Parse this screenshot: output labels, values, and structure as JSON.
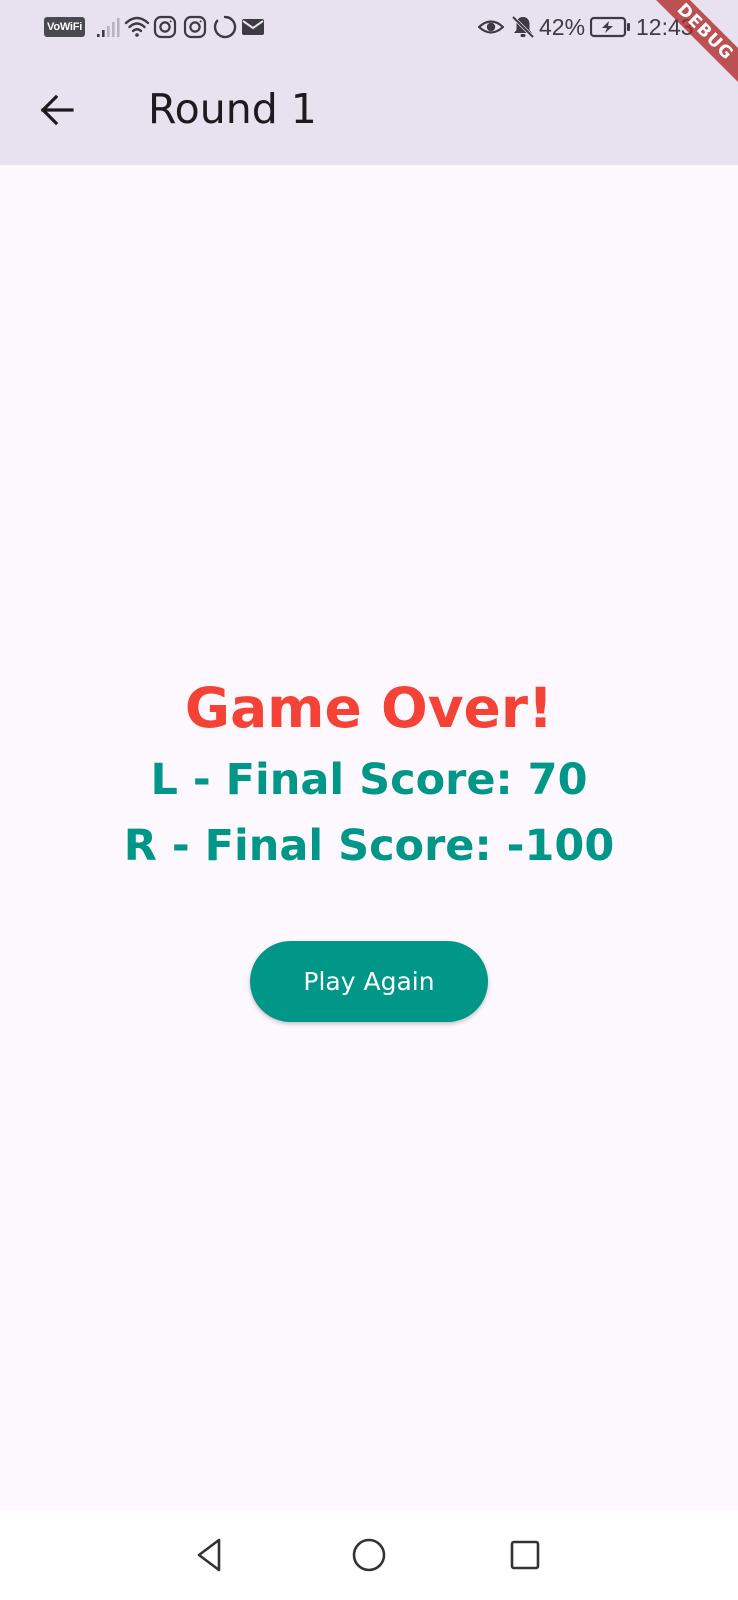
{
  "status_bar": {
    "vowifi_label": "VoWiFi",
    "battery_percent": "42%",
    "time": "12:43",
    "icons": [
      "vowifi-icon",
      "signal-icon",
      "wifi-icon",
      "instagram-icon",
      "instagram-icon",
      "sync-icon",
      "mail-icon",
      "eye-icon",
      "bell-muted-icon",
      "battery-charging-icon"
    ]
  },
  "app_bar": {
    "back_icon": "arrow-back-icon",
    "title": "Round 1"
  },
  "debug_banner": {
    "label": "DEBUG",
    "color": "#B02828"
  },
  "result": {
    "heading": "Game Over!",
    "left_score": "L - Final Score: 70",
    "right_score": "R - Final Score: -100",
    "play_again_label": "Play Again"
  },
  "colors": {
    "heading": "#F44336",
    "score": "#009688",
    "button": "#009688",
    "app_bar": "#E8E1F0",
    "background": "#FDF7FE"
  },
  "nav_bar": {
    "icons": [
      "back-triangle-icon",
      "home-circle-icon",
      "recents-square-icon"
    ]
  }
}
